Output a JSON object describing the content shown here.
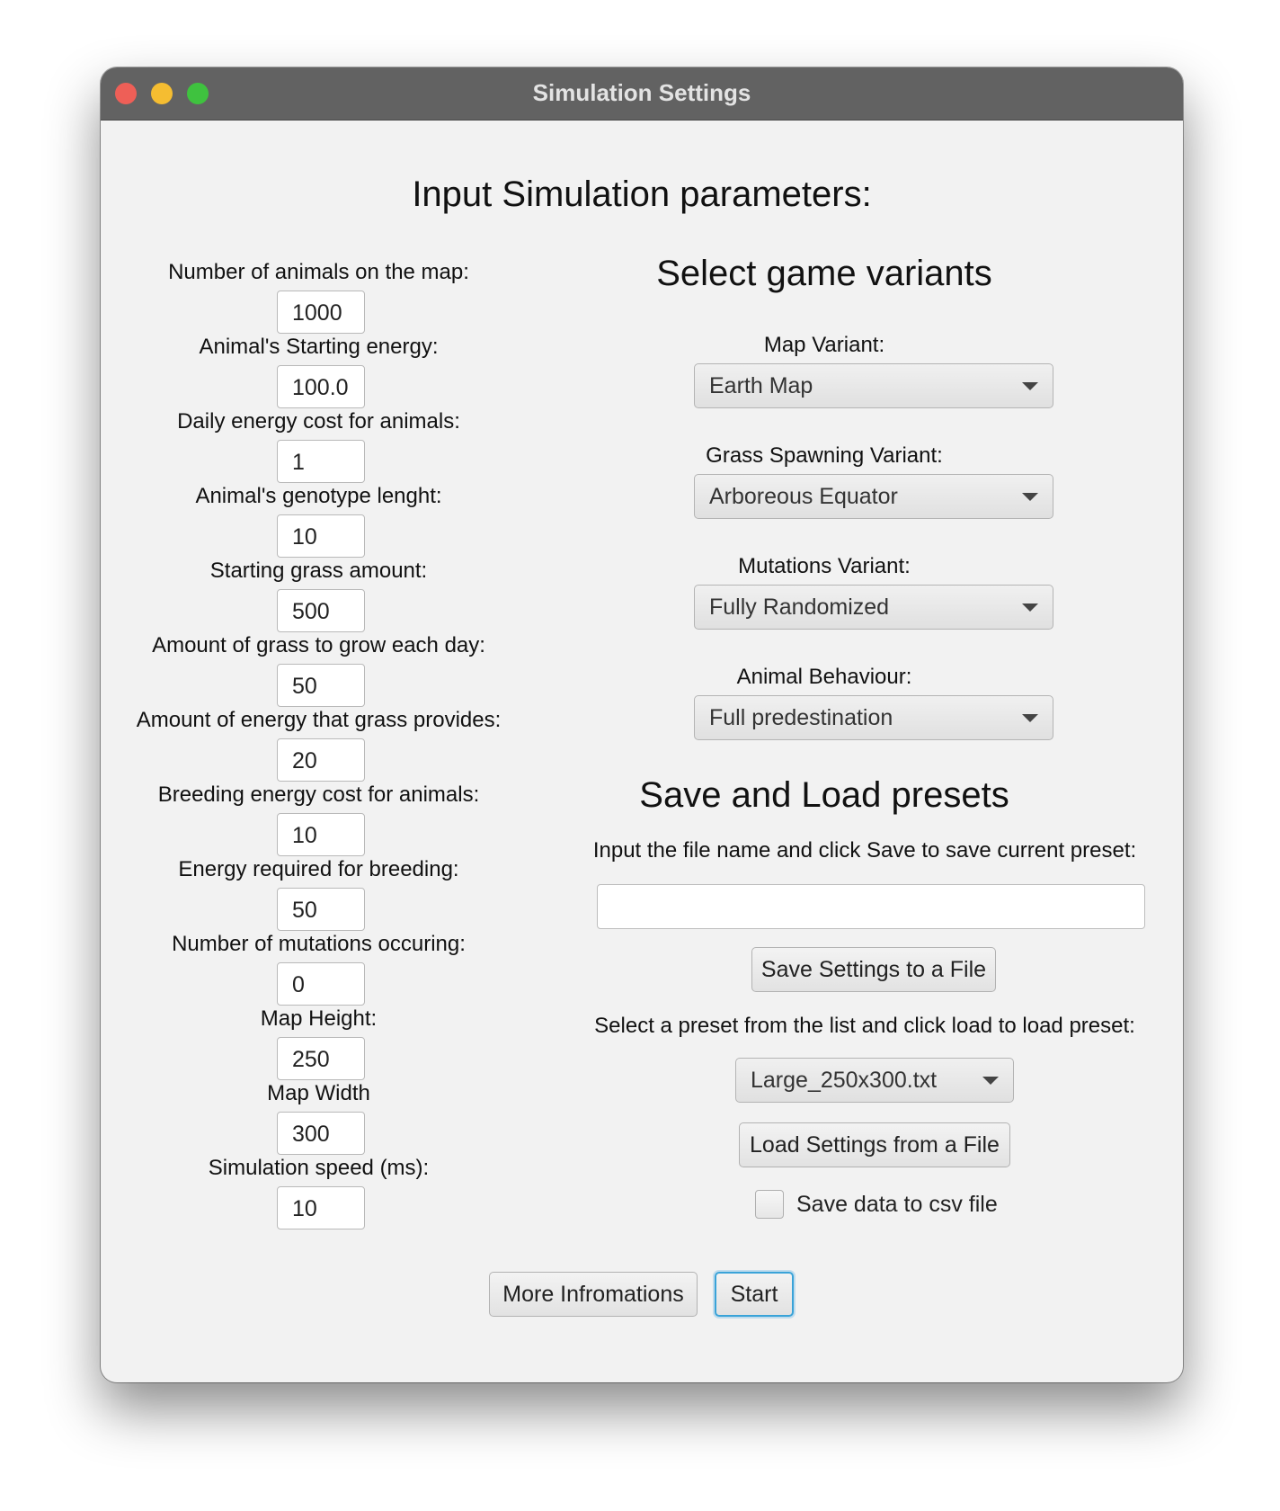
{
  "window": {
    "title": "Simulation Settings"
  },
  "heading": "Input Simulation parameters:",
  "params": [
    {
      "label": "Number of animals on the map:",
      "value": "1000"
    },
    {
      "label": "Animal's Starting energy:",
      "value": "100.0"
    },
    {
      "label": "Daily energy cost for animals:",
      "value": "1"
    },
    {
      "label": "Animal's genotype lenght:",
      "value": "10"
    },
    {
      "label": "Starting grass amount:",
      "value": "500"
    },
    {
      "label": "Amount of grass to grow each day:",
      "value": "50"
    },
    {
      "label": "Amount of energy that grass provides:",
      "value": "20"
    },
    {
      "label": "Breeding energy cost for animals:",
      "value": "10"
    },
    {
      "label": "Energy required for breeding:",
      "value": "50"
    },
    {
      "label": "Number of mutations occuring:",
      "value": "0"
    },
    {
      "label": "Map Height:",
      "value": "250"
    },
    {
      "label": "Map Width",
      "value": "300"
    },
    {
      "label": "Simulation speed (ms):",
      "value": "10"
    }
  ],
  "variants": {
    "heading": "Select game variants",
    "items": [
      {
        "label": "Map Variant:",
        "value": "Earth Map"
      },
      {
        "label": "Grass Spawning Variant:",
        "value": "Arboreous Equator"
      },
      {
        "label": "Mutations Variant:",
        "value": "Fully Randomized"
      },
      {
        "label": "Animal Behaviour:",
        "value": "Full predestination"
      }
    ]
  },
  "presets": {
    "heading": "Save and Load presets",
    "save_instruction": "Input the file name and click Save to save current preset:",
    "filename_value": "",
    "save_button": "Save Settings to a File",
    "load_instruction": "Select a preset from the list and click load to load preset:",
    "selected_preset": "Large_250x300.txt",
    "load_button": "Load Settings from a File",
    "csv_checkbox_label": "Save data to csv file",
    "csv_checked": false
  },
  "footer": {
    "more_button": "More Infromations",
    "start_button": "Start"
  }
}
